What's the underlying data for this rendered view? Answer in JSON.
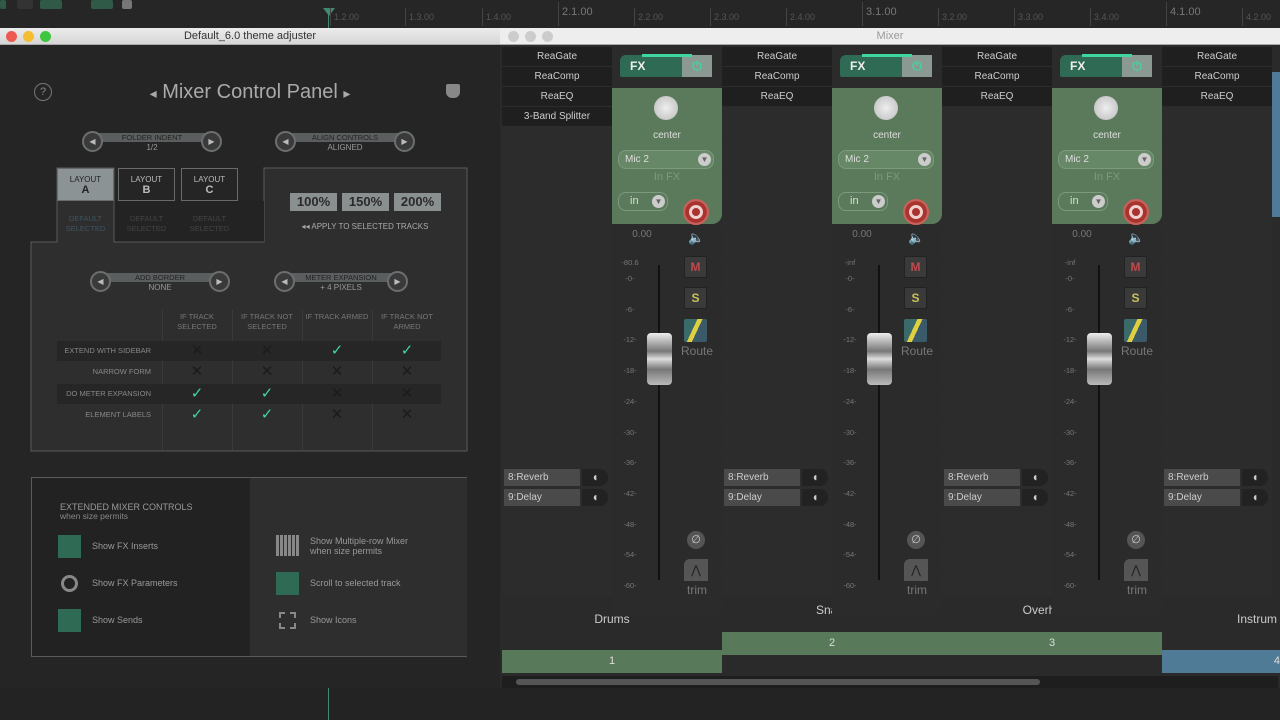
{
  "timeline": {
    "labels": [
      {
        "t": "1.2.00",
        "major": false
      },
      {
        "t": "1.3.00",
        "major": false
      },
      {
        "t": "1.4.00",
        "major": false
      },
      {
        "t": "2.1.00",
        "major": true
      },
      {
        "t": "2.2.00",
        "major": false
      },
      {
        "t": "2.3.00",
        "major": false
      },
      {
        "t": "2.4.00",
        "major": false
      },
      {
        "t": "3.1.00",
        "major": true
      },
      {
        "t": "3.2.00",
        "major": false
      },
      {
        "t": "3.3.00",
        "major": false
      },
      {
        "t": "3.4.00",
        "major": false
      },
      {
        "t": "4.1.00",
        "major": true
      },
      {
        "t": "4.2.00",
        "major": false
      }
    ]
  },
  "theme_window": {
    "title": "Default_6.0 theme adjuster",
    "panel_title": "Mixer Control Panel",
    "prev_arrow": "◂",
    "next_arrow": "▸",
    "help": "?",
    "folder_indent": {
      "label": "FOLDER INDENT",
      "value": "1/2"
    },
    "align_controls": {
      "label": "ALIGN CONTROLS",
      "value": "ALIGNED"
    },
    "add_border": {
      "label": "ADD BORDER",
      "value": "NONE"
    },
    "meter_expansion": {
      "label": "METER EXPANSION",
      "value": "+ 4 PIXELS"
    },
    "layouts": [
      {
        "label": "LAYOUT",
        "letter": "A",
        "sub": "DEFAULT SELECTED",
        "selected": true
      },
      {
        "label": "LAYOUT",
        "letter": "B",
        "sub": "DEFAULT SELECTED",
        "selected": false
      },
      {
        "label": "LAYOUT",
        "letter": "C",
        "sub": "DEFAULT SELECTED",
        "selected": false
      }
    ],
    "scales": [
      "100%",
      "150%",
      "200%"
    ],
    "apply_label": "◂◂  APPLY TO SELECTED TRACKS",
    "columns": [
      "IF TRACK SELECTED",
      "IF TRACK NOT SELECTED",
      "IF TRACK ARMED",
      "IF TRACK NOT ARMED"
    ],
    "rows": [
      {
        "label": "EXTEND WITH SIDEBAR",
        "values": [
          false,
          false,
          true,
          true
        ]
      },
      {
        "label": "NARROW FORM",
        "values": [
          false,
          false,
          false,
          false
        ]
      },
      {
        "label": "DO METER EXPANSION",
        "values": [
          true,
          true,
          false,
          false
        ]
      },
      {
        "label": "ELEMENT LABELS",
        "values": [
          true,
          true,
          false,
          false
        ]
      }
    ],
    "extended": {
      "title": "EXTENDED MIXER CONTROLS",
      "subtitle": "when size permits",
      "left": [
        {
          "label": "Show FX Inserts",
          "icon": "fx-icon",
          "on": true
        },
        {
          "label": "Show FX Parameters",
          "icon": "knob-icon",
          "on": false
        },
        {
          "label": "Show Sends",
          "icon": "send-icon",
          "on": true
        }
      ],
      "right": [
        {
          "label": "Show Multiple-row Mixer",
          "label2": "when size permits",
          "icon": "grid-icon",
          "on": false
        },
        {
          "label": "Scroll to selected track",
          "label2": "",
          "icon": "scroll-search-icon",
          "on": true
        },
        {
          "label": "Show Icons",
          "label2": "",
          "icon": "frame-icon",
          "on": false
        }
      ]
    },
    "accent": "#3fd6a0"
  },
  "mixer": {
    "title": "Mixer",
    "fx_label": "FX",
    "pan": "center",
    "input": "Mic 2",
    "infx": "In FX",
    "monitor": "in",
    "volume": "0.00",
    "mute": "M",
    "solo": "S",
    "route": "Route",
    "trim": "trim",
    "phase": "∅",
    "scale": [
      "-0-",
      "-6-",
      "-12-",
      "-18-",
      "-24-",
      "-30-",
      "-36-",
      "-42-",
      "-48-",
      "-54-",
      "-60-"
    ],
    "tracks": [
      {
        "name": "Drums",
        "number": "1",
        "peak": "-80.6",
        "fx": [
          "ReaGate",
          "ReaComp",
          "ReaEQ",
          "3-Band Splitter"
        ],
        "sends": [
          "8:Reverb",
          "9:Delay"
        ],
        "color": "#587a5a"
      },
      {
        "name": "Snare",
        "number": "2",
        "peak": "-inf",
        "fx": [
          "ReaGate",
          "ReaComp",
          "ReaEQ"
        ],
        "sends": [
          "8:Reverb",
          "9:Delay"
        ],
        "color": "#587a5a"
      },
      {
        "name": "Overheads",
        "number": "3",
        "peak": "-inf",
        "fx": [
          "ReaGate",
          "ReaComp",
          "ReaEQ"
        ],
        "sends": [
          "8:Reverb",
          "9:Delay"
        ],
        "color": "#587a5a"
      },
      {
        "name": "Instrum",
        "number": "4",
        "peak": "",
        "fx": [
          "ReaGate",
          "ReaComp",
          "ReaEQ"
        ],
        "sends": [
          "8:Reverb",
          "9:Delay"
        ],
        "color": "#4f7b96"
      }
    ]
  }
}
